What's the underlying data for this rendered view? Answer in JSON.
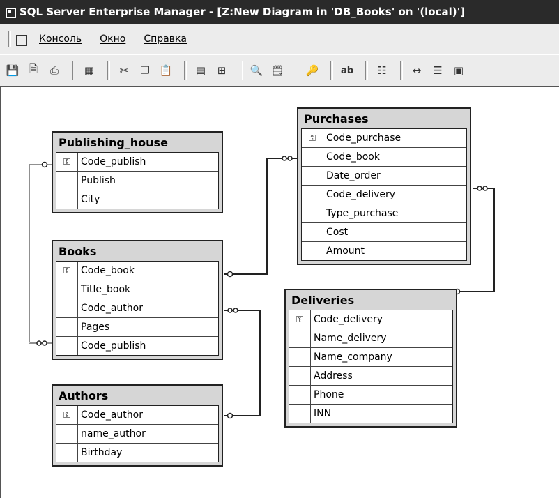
{
  "window": {
    "title": "SQL Server Enterprise Manager - [Z:New Diagram in 'DB_Books' on '(local)']"
  },
  "menu": [
    "Консоль",
    "Окно",
    "Справка"
  ],
  "toolbar_icons": [
    "save-icon",
    "properties-icon",
    "print-icon",
    "table-icon",
    "cut-icon",
    "copy-icon",
    "paste-icon",
    "new-table-icon",
    "add-related-icon",
    "zoom-icon",
    "text-annotation-icon",
    "key-icon",
    "label-icon",
    "layout-icon",
    "relationship-icon",
    "indexes-icon",
    "grid-icon"
  ],
  "tables": {
    "publishing_house": {
      "name": "Publishing_house",
      "fields": [
        {
          "name": "Code_publish",
          "key": true
        },
        {
          "name": "Publish",
          "key": false
        },
        {
          "name": "City",
          "key": false
        }
      ]
    },
    "books": {
      "name": "Books",
      "fields": [
        {
          "name": "Code_book",
          "key": true
        },
        {
          "name": "Title_book",
          "key": false
        },
        {
          "name": "Code_author",
          "key": false
        },
        {
          "name": "Pages",
          "key": false
        },
        {
          "name": "Code_publish",
          "key": false
        }
      ]
    },
    "authors": {
      "name": "Authors",
      "fields": [
        {
          "name": "Code_author",
          "key": true
        },
        {
          "name": "name_author",
          "key": false
        },
        {
          "name": "Birthday",
          "key": false
        }
      ]
    },
    "purchases": {
      "name": "Purchases",
      "fields": [
        {
          "name": "Code_purchase",
          "key": true
        },
        {
          "name": "Code_book",
          "key": false
        },
        {
          "name": "Date_order",
          "key": false
        },
        {
          "name": "Code_delivery",
          "key": false
        },
        {
          "name": "Type_purchase",
          "key": false
        },
        {
          "name": "Cost",
          "key": false
        },
        {
          "name": "Amount",
          "key": false
        }
      ]
    },
    "deliveries": {
      "name": "Deliveries",
      "fields": [
        {
          "name": "Code_delivery",
          "key": true
        },
        {
          "name": "Name_delivery",
          "key": false
        },
        {
          "name": "Name_company",
          "key": false
        },
        {
          "name": "Address",
          "key": false
        },
        {
          "name": "Phone",
          "key": false
        },
        {
          "name": "INN",
          "key": false
        }
      ]
    }
  }
}
